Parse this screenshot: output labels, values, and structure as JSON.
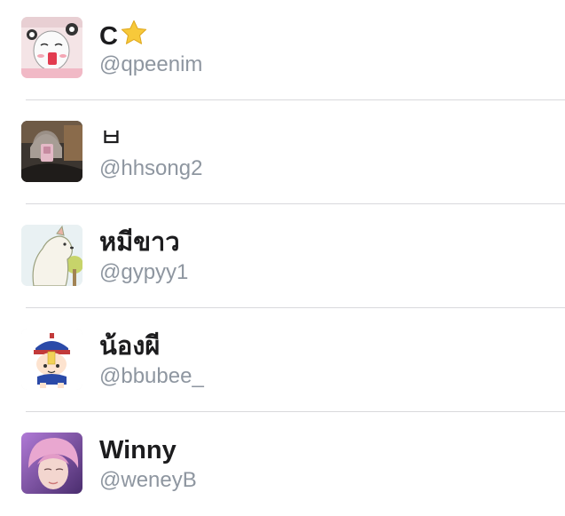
{
  "users": [
    {
      "name": "C",
      "handle": "@qpeenim",
      "name_emoji": "star-icon",
      "avatar": "anime-character-avatar"
    },
    {
      "name": "ㅂ",
      "handle": "@hhsong2",
      "avatar": "mirror-selfie-avatar"
    },
    {
      "name": "หมีขาว",
      "handle": "@gypyy1",
      "avatar": "polar-bear-cartoon-avatar"
    },
    {
      "name": "น้องผี",
      "handle": "@bbubee_",
      "avatar": "jiangshi-cartoon-avatar"
    },
    {
      "name": "Winny",
      "handle": "@weneyB",
      "avatar": "pink-hair-photo-avatar"
    }
  ],
  "colors": {
    "name_text": "#1c1c1e",
    "handle_text": "#8e96a0",
    "divider": "#d9d9dc",
    "star": "#f7c93a"
  }
}
